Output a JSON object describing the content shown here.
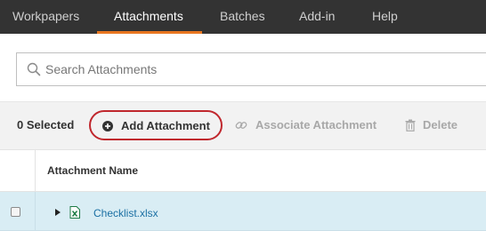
{
  "nav": {
    "tabs": [
      {
        "label": "Workpapers",
        "active": false
      },
      {
        "label": "Attachments",
        "active": true
      },
      {
        "label": "Batches",
        "active": false
      },
      {
        "label": "Add-in",
        "active": false
      },
      {
        "label": "Help",
        "active": false
      }
    ],
    "accent_color": "#e8761f"
  },
  "search": {
    "placeholder": "Search Attachments",
    "value": "",
    "icon": "search-icon"
  },
  "toolbar": {
    "selected_count": "0 Selected",
    "add_label": "Add Attachment",
    "add_icon": "plus-circle-icon",
    "highlight_color": "#c0272d",
    "associate_label": "Associate Attachment",
    "associate_icon": "link-icon",
    "delete_label": "Delete",
    "delete_icon": "trash-icon"
  },
  "table": {
    "columns": [
      "Attachment Name"
    ],
    "rows": [
      {
        "name": "Checklist.xlsx",
        "icon": "excel-file-icon",
        "selected": false,
        "row_color": "#d9edf4"
      }
    ]
  }
}
